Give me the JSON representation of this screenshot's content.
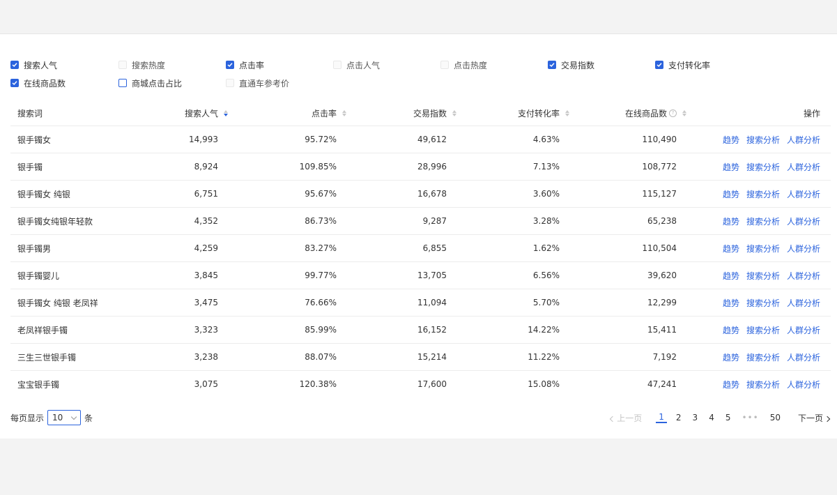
{
  "filters": [
    {
      "label": "搜索人气",
      "state": "checked"
    },
    {
      "label": "搜索热度",
      "state": "disabled"
    },
    {
      "label": "点击率",
      "state": "checked"
    },
    {
      "label": "点击人气",
      "state": "disabled"
    },
    {
      "label": "点击热度",
      "state": "disabled"
    },
    {
      "label": "交易指数",
      "state": "checked"
    },
    {
      "label": "支付转化率",
      "state": "checked"
    },
    {
      "label": "在线商品数",
      "state": "checked"
    },
    {
      "label": "商城点击占比",
      "state": "unchecked"
    },
    {
      "label": "直通车参考价",
      "state": "disabled"
    }
  ],
  "table": {
    "headers": {
      "keyword": "搜索词",
      "search_popularity": "搜索人气",
      "ctr": "点击率",
      "trade_index": "交易指数",
      "conversion": "支付转化率",
      "online_goods": "在线商品数",
      "actions": "操作"
    },
    "action_labels": {
      "trend": "趋势",
      "search_analysis": "搜索分析",
      "crowd_analysis": "人群分析"
    },
    "rows": [
      {
        "keyword": "银手镯女",
        "search_popularity": "14,993",
        "ctr": "95.72%",
        "trade_index": "49,612",
        "conversion": "4.63%",
        "online_goods": "110,490"
      },
      {
        "keyword": "银手镯",
        "search_popularity": "8,924",
        "ctr": "109.85%",
        "trade_index": "28,996",
        "conversion": "7.13%",
        "online_goods": "108,772"
      },
      {
        "keyword": "银手镯女 纯银",
        "search_popularity": "6,751",
        "ctr": "95.67%",
        "trade_index": "16,678",
        "conversion": "3.60%",
        "online_goods": "115,127"
      },
      {
        "keyword": "银手镯女纯银年轻款",
        "search_popularity": "4,352",
        "ctr": "86.73%",
        "trade_index": "9,287",
        "conversion": "3.28%",
        "online_goods": "65,238"
      },
      {
        "keyword": "银手镯男",
        "search_popularity": "4,259",
        "ctr": "83.27%",
        "trade_index": "6,855",
        "conversion": "1.62%",
        "online_goods": "110,504"
      },
      {
        "keyword": "银手镯婴儿",
        "search_popularity": "3,845",
        "ctr": "99.77%",
        "trade_index": "13,705",
        "conversion": "6.56%",
        "online_goods": "39,620"
      },
      {
        "keyword": "银手镯女 纯银 老凤祥",
        "search_popularity": "3,475",
        "ctr": "76.66%",
        "trade_index": "11,094",
        "conversion": "5.70%",
        "online_goods": "12,299"
      },
      {
        "keyword": "老凤祥银手镯",
        "search_popularity": "3,323",
        "ctr": "85.99%",
        "trade_index": "16,152",
        "conversion": "14.22%",
        "online_goods": "15,411"
      },
      {
        "keyword": "三生三世银手镯",
        "search_popularity": "3,238",
        "ctr": "88.07%",
        "trade_index": "15,214",
        "conversion": "11.22%",
        "online_goods": "7,192"
      },
      {
        "keyword": "宝宝银手镯",
        "search_popularity": "3,075",
        "ctr": "120.38%",
        "trade_index": "17,600",
        "conversion": "15.08%",
        "online_goods": "47,241"
      }
    ]
  },
  "pagination": {
    "page_size_prefix": "每页显示",
    "page_size_value": "10",
    "page_size_suffix": "条",
    "prev_label": "上一页",
    "next_label": "下一页",
    "pages": [
      "1",
      "2",
      "3",
      "4",
      "5"
    ],
    "ellipsis": "•••",
    "last_page": "50",
    "current_page": "1"
  },
  "colors": {
    "accent": "#2b63dd",
    "border": "#ececec",
    "background": "#f3f3f3"
  }
}
